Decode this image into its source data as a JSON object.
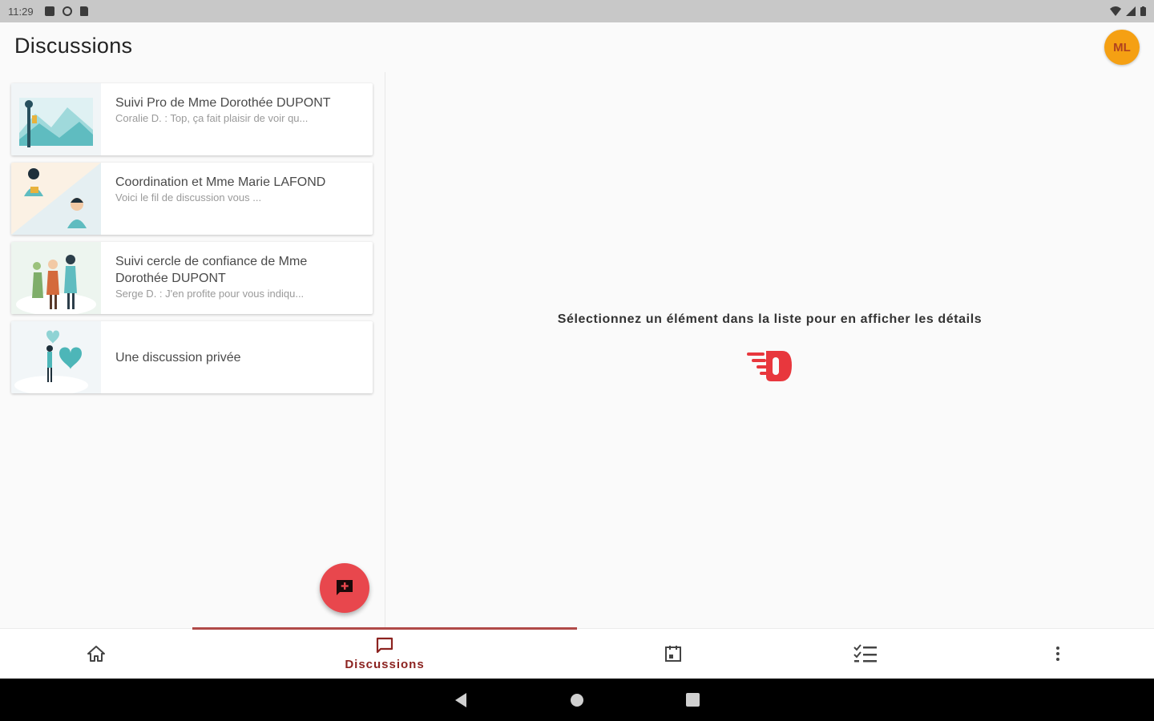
{
  "status_bar": {
    "time": "11:29"
  },
  "header": {
    "title": "Discussions",
    "avatar_initials": "ML"
  },
  "discussions": [
    {
      "title": "Suivi Pro de Mme Dorothée DUPONT",
      "preview": "Coralie D. : Top, ça fait plaisir de voir qu..."
    },
    {
      "title": "Coordination et Mme Marie LAFOND",
      "preview": "Voici le fil de discussion vous ..."
    },
    {
      "title": "Suivi cercle de confiance de Mme Dorothée DUPONT",
      "preview": "Serge D. : J'en profite pour vous indiqu..."
    },
    {
      "title": "Une discussion privée",
      "preview": ""
    }
  ],
  "detail": {
    "empty_message": "Sélectionnez un élément dans la liste pour en afficher les détails"
  },
  "bottom_nav": {
    "items": [
      {
        "icon": "home-icon",
        "label": ""
      },
      {
        "icon": "chat-icon",
        "label": "Discussions",
        "active": true
      },
      {
        "icon": "calendar-icon",
        "label": ""
      },
      {
        "icon": "checklist-icon",
        "label": ""
      },
      {
        "icon": "more-vert-icon",
        "label": ""
      }
    ]
  },
  "colors": {
    "accent": "#e8474d",
    "active_nav": "#8c2320",
    "avatar_bg": "#f5a013"
  }
}
